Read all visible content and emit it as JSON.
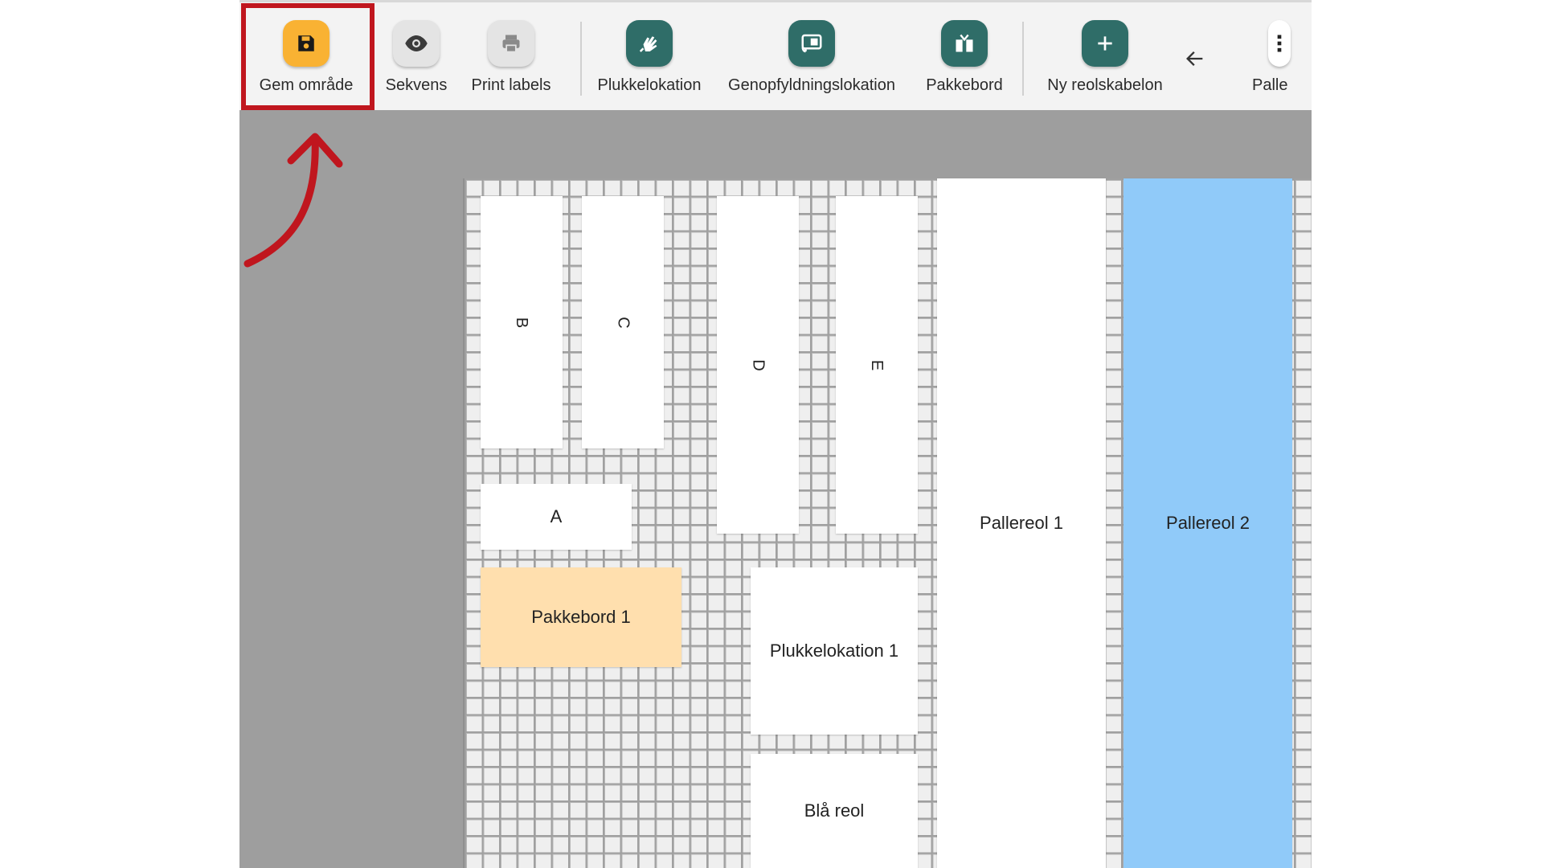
{
  "toolbar": {
    "buttons": [
      {
        "label": "Gem område",
        "icon": "save-icon"
      },
      {
        "label": "Sekvens",
        "icon": "eye-icon"
      },
      {
        "label": "Print labels",
        "icon": "printer-icon"
      },
      {
        "label": "Plukkelokation",
        "icon": "hand-pick-icon"
      },
      {
        "label": "Genopfyldningslokation",
        "icon": "refill-icon"
      },
      {
        "label": "Pakkebord",
        "icon": "package-icon"
      },
      {
        "label": "Ny reolskabelon",
        "icon": "plus-icon"
      },
      {
        "label": "Palle",
        "icon": "more-vertical-icon"
      }
    ],
    "back_icon": "arrow-left-icon"
  },
  "layout": {
    "shelves": [
      {
        "label": "B"
      },
      {
        "label": "C"
      },
      {
        "label": "D"
      },
      {
        "label": "E"
      },
      {
        "label": "A"
      },
      {
        "label": "Pakkebord 1"
      },
      {
        "label": "Plukkelokation 1"
      },
      {
        "label": "Blå reol"
      },
      {
        "label": "Pallereol 1"
      },
      {
        "label": "Pallereol 2"
      }
    ]
  },
  "colors": {
    "save_accent": "#f9b233",
    "teal_action": "#2f6d68",
    "packing_table": "#ffdfae",
    "pallet_selected": "#90caf9",
    "highlight_red": "#c0161e"
  }
}
